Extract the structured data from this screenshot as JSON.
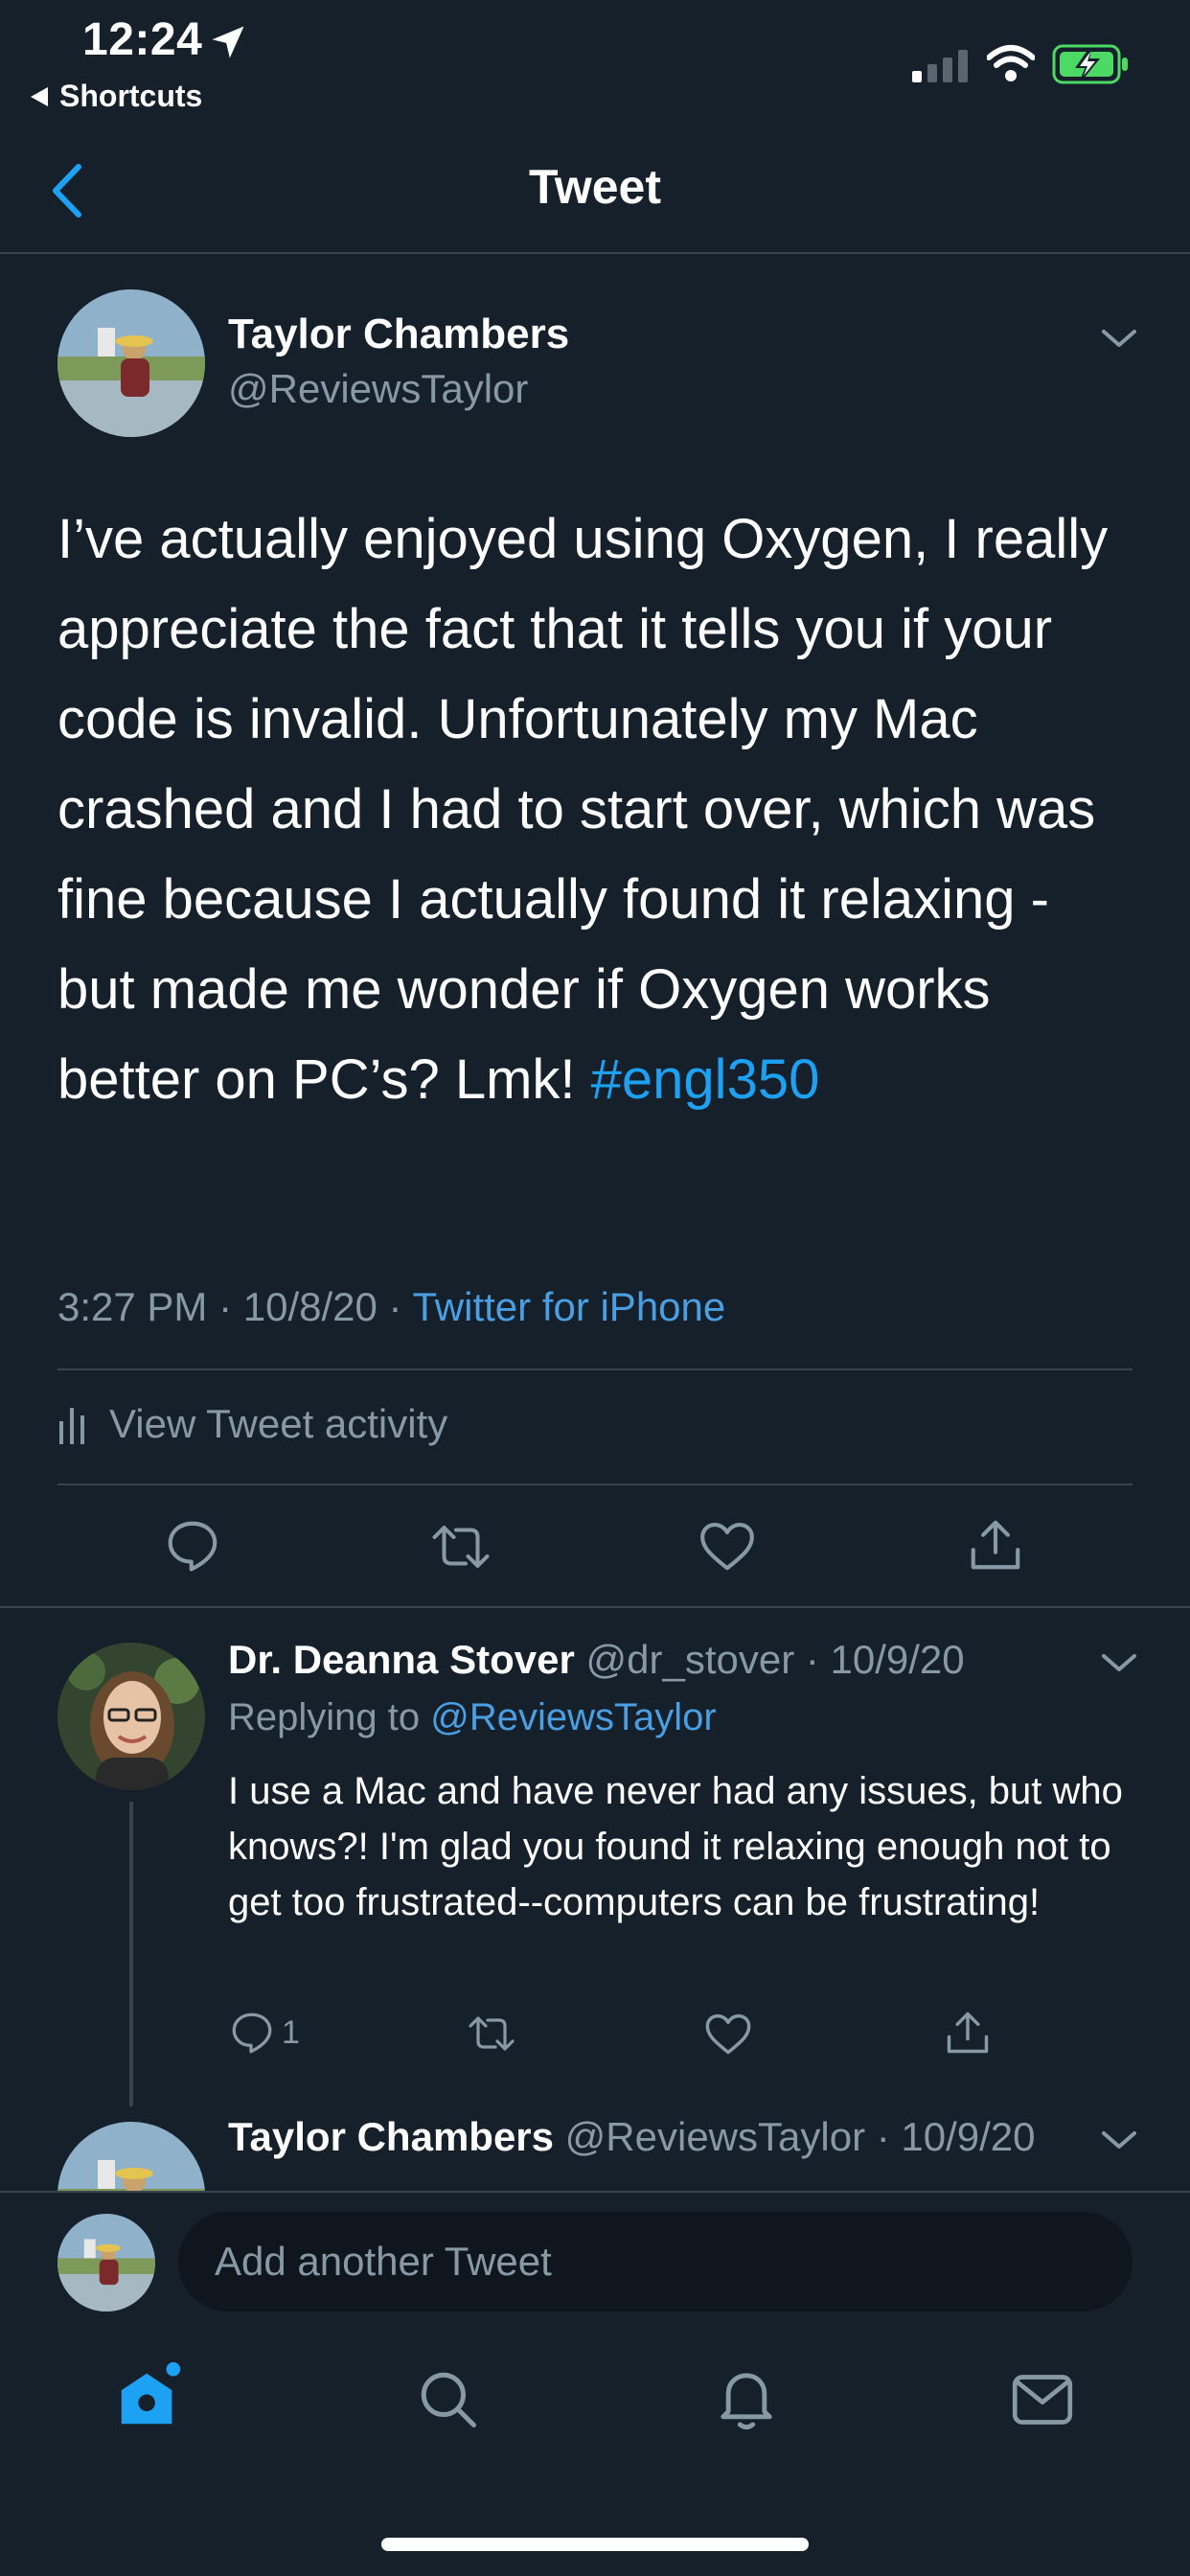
{
  "status_bar": {
    "time": "12:24",
    "back_app": "Shortcuts",
    "battery_color": "#4cd964"
  },
  "nav": {
    "title": "Tweet"
  },
  "tweet": {
    "author_name": "Taylor Chambers",
    "author_handle": "@ReviewsTaylor",
    "text": "I’ve actually enjoyed using Oxygen, I really appreciate the fact that it tells you if your code is invalid. Unfortunately my Mac crashed and I had to start over, which was fine because I actually found it relaxing - but made me wonder if Oxygen works better on PC’s? Lmk!",
    "hashtag": "#engl350",
    "time": "3:27 PM · 10/8/20 · ",
    "source": "Twitter for iPhone",
    "activity_label": "View Tweet activity"
  },
  "replies": [
    {
      "name": "Dr. Deanna Stover",
      "handle_date": "@dr_stover · 10/9/20",
      "replying_prefix": "Replying to ",
      "replying_to": "@ReviewsTaylor",
      "text": "I use a Mac and have never had any issues, but who knows?! I'm glad you found it relaxing enough not to get too frustrated--computers can be frustrating!",
      "reply_count": "1"
    },
    {
      "name": "Taylor Chambers",
      "handle_date": "@ReviewsTaylor · 10/9/20"
    }
  ],
  "compose": {
    "placeholder": "Add another Tweet"
  },
  "tab_bar": {
    "items": [
      "home-icon",
      "search-icon",
      "notifications-icon",
      "messages-icon"
    ],
    "active_color": "#1da1f2"
  },
  "colors": {
    "background": "#15202b",
    "link": "#1da1f2",
    "muted": "#8899a6",
    "divider": "#38444d"
  }
}
